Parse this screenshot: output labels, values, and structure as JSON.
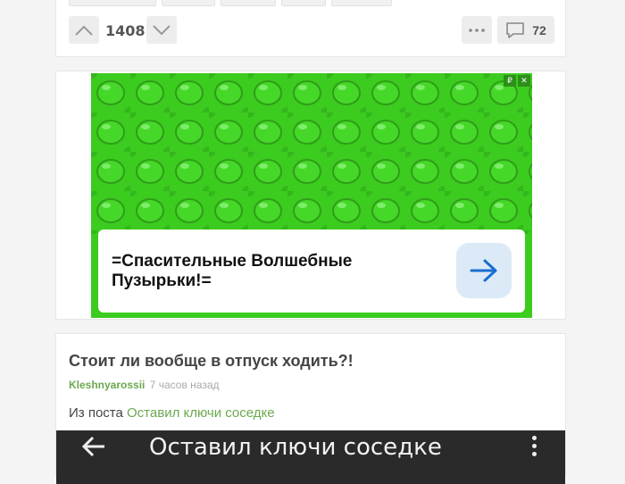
{
  "top_post": {
    "tags": [
      "",
      "",
      "",
      "",
      ""
    ],
    "rating": "1408",
    "comments_count": "72"
  },
  "ad": {
    "title": "=Спасительные Волшебные Пузырьки!=",
    "badge_left": "₽",
    "badge_right": "✕"
  },
  "post": {
    "title": "Стоит ли вообще в отпуск ходить?!",
    "author": "Kleshnyarossii",
    "time": "7 часов назад",
    "text_prefix": "Из поста",
    "link_text": "Оставил ключи соседке",
    "image_title": "Оставил ключи соседке"
  },
  "colors": {
    "accent_green": "#6aa84f",
    "ad_green": "#3ccb1f",
    "arrow_blue": "#1a6fd1"
  }
}
